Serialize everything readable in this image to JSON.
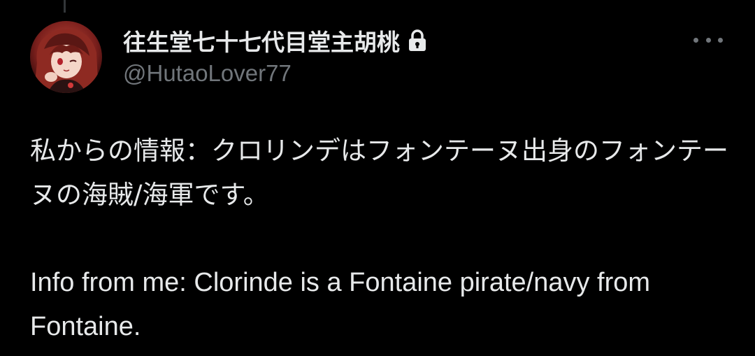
{
  "tweet": {
    "display_name": "往生堂七十七代目堂主胡桃",
    "handle": "@HutaoLover77",
    "protected": true,
    "body_jp": "私からの情報：クロリンデはフォンテーヌ出身のフォンテーヌの海賊/海軍です。",
    "body_en": "Info from me: Clorinde is a Fontaine pirate/navy from Fontaine."
  },
  "icons": {
    "lock": "lock-icon",
    "more": "more-options-icon",
    "avatar": "profile-avatar"
  },
  "colors": {
    "background": "#000000",
    "primary_text": "#e7e9ea",
    "secondary_text": "#71767b"
  }
}
